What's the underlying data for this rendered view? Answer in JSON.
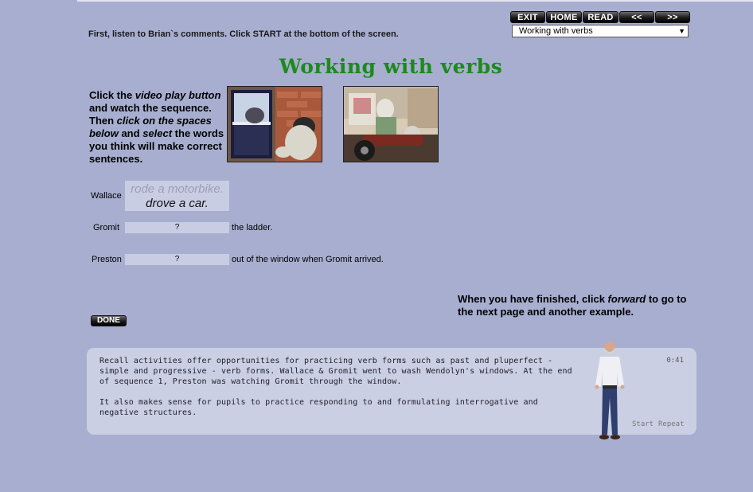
{
  "nav": {
    "exit": "EXIT",
    "home": "HOME",
    "read": "READ",
    "back": "<<",
    "forward": ">>"
  },
  "topic_select": {
    "value": "Working with verbs"
  },
  "intro": "First, listen to Brian`s comments. Click START at the bottom of the screen.",
  "title": "Working with verbs",
  "instructions": {
    "p1": "Click the ",
    "p1_em": "video play button",
    "p2": " and watch the sequence. Then ",
    "p2_em": "click on the spaces below",
    "p3": " and ",
    "p3_em": "select",
    "p4": " the words you think will make correct sentences."
  },
  "exercise": {
    "rows": [
      {
        "subject": "Wallace",
        "gap": "",
        "rest": ""
      },
      {
        "subject": "Gromit",
        "gap": "?",
        "rest": "the ladder."
      },
      {
        "subject": "Preston",
        "gap": "?",
        "rest": "out of the window when Gromit arrived."
      }
    ],
    "choices": [
      "rode a motorbike.",
      "drove a car."
    ]
  },
  "finish": {
    "a": "When you have finished, click ",
    "em": "forward",
    "b": " to go to the next page and another example."
  },
  "done_label": "DONE",
  "commentary": {
    "p1": "Recall activities offer opportunities for practicing verb forms such as past and pluperfect - simple and progressive - verb forms. Wallace & Gromit went to wash Wendolyn's windows. At the end of sequence 1, Preston was watching Gromit through the window.",
    "p2": "It also makes sense for pupils to practice responding to and formulating interrogative and negative structures.",
    "timer": "0:41",
    "start": "Start",
    "repeat": "Repeat"
  },
  "colors": {
    "background": "#a7aed0",
    "title": "#1c8a1c",
    "panel": "#cbcfe4",
    "gap": "#c8cde3"
  }
}
